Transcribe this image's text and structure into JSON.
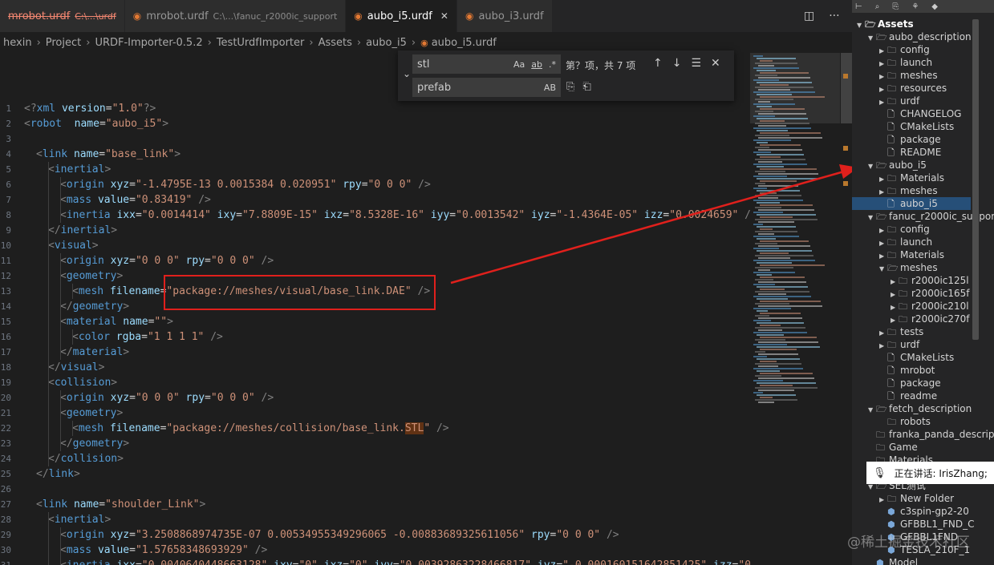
{
  "tabs": [
    {
      "name": "mrobot.urdf",
      "hint": "C:\\...\\urdf",
      "state": "deleted"
    },
    {
      "name": "mrobot.urdf",
      "hint": "C:\\...\\fanuc_r2000ic_support"
    },
    {
      "name": "aubo_i5.urdf",
      "active": true
    },
    {
      "name": "aubo_i3.urdf"
    }
  ],
  "tab_actions": {
    "split_icon": "split-editor-icon",
    "more_icon": "ellipsis-icon",
    "split": "◫",
    "more": "···"
  },
  "breadcrumb": [
    "hexin",
    "Project",
    "URDF-Importer-0.5.2",
    "TestUrdfImporter",
    "Assets",
    "aubo_i5",
    "aubo_i5.urdf"
  ],
  "find": {
    "find_value": "stl",
    "replace_value": "prefab",
    "opt_case": "Aa",
    "opt_word": "ab",
    "opt_regex": ".*",
    "opt_preserve": "AB",
    "result": "第？项，共 7 项",
    "prev": "↑",
    "next": "↓",
    "selection": "☰",
    "close": "✕",
    "replace_one": "⎘",
    "replace_all": "⎗"
  },
  "code": [
    {
      "n": "1",
      "ind": 0,
      "p": [
        [
          "p",
          "<?"
        ],
        [
          "t",
          "xml"
        ],
        [
          "a",
          " version"
        ],
        [
          "x",
          "="
        ],
        [
          "s",
          "\"1.0\""
        ],
        [
          "p",
          "?>"
        ]
      ]
    },
    {
      "n": "2",
      "ind": 0,
      "p": [
        [
          "p",
          "<"
        ],
        [
          "t",
          "robot"
        ],
        [
          "a",
          "  name"
        ],
        [
          "x",
          "="
        ],
        [
          "s",
          "\"aubo_i5\""
        ],
        [
          "p",
          ">"
        ]
      ]
    },
    {
      "n": "3",
      "ind": 0,
      "p": []
    },
    {
      "n": "4",
      "ind": 1,
      "p": [
        [
          "p",
          "<"
        ],
        [
          "t",
          "link"
        ],
        [
          "a",
          " name"
        ],
        [
          "x",
          "="
        ],
        [
          "s",
          "\"base_link\""
        ],
        [
          "p",
          ">"
        ]
      ]
    },
    {
      "n": "5",
      "ind": 2,
      "p": [
        [
          "p",
          "<"
        ],
        [
          "t",
          "inertial"
        ],
        [
          "p",
          ">"
        ]
      ]
    },
    {
      "n": "6",
      "ind": 3,
      "p": [
        [
          "p",
          "<"
        ],
        [
          "t",
          "origin"
        ],
        [
          "a",
          " xyz"
        ],
        [
          "x",
          "="
        ],
        [
          "s",
          "\"-1.4795E-13 0.0015384 0.020951\""
        ],
        [
          "a",
          " rpy"
        ],
        [
          "x",
          "="
        ],
        [
          "s",
          "\"0 0 0\""
        ],
        [
          "p",
          " />"
        ]
      ]
    },
    {
      "n": "7",
      "ind": 3,
      "p": [
        [
          "p",
          "<"
        ],
        [
          "t",
          "mass"
        ],
        [
          "a",
          " value"
        ],
        [
          "x",
          "="
        ],
        [
          "s",
          "\"0.83419\""
        ],
        [
          "p",
          " />"
        ]
      ]
    },
    {
      "n": "8",
      "ind": 3,
      "p": [
        [
          "p",
          "<"
        ],
        [
          "t",
          "inertia"
        ],
        [
          "a",
          " ixx"
        ],
        [
          "x",
          "="
        ],
        [
          "s",
          "\"0.0014414\""
        ],
        [
          "a",
          " ixy"
        ],
        [
          "x",
          "="
        ],
        [
          "s",
          "\"7.8809E-15\""
        ],
        [
          "a",
          " ixz"
        ],
        [
          "x",
          "="
        ],
        [
          "s",
          "\"8.5328E-16\""
        ],
        [
          "a",
          " iyy"
        ],
        [
          "x",
          "="
        ],
        [
          "s",
          "\"0.0013542\""
        ],
        [
          "a",
          " iyz"
        ],
        [
          "x",
          "="
        ],
        [
          "s",
          "\"-1.4364E-05\""
        ],
        [
          "a",
          " izz"
        ],
        [
          "x",
          "="
        ],
        [
          "s",
          "\"0.0024659\""
        ],
        [
          "p",
          " />"
        ]
      ]
    },
    {
      "n": "9",
      "ind": 2,
      "p": [
        [
          "p",
          "</"
        ],
        [
          "t",
          "inertial"
        ],
        [
          "p",
          ">"
        ]
      ]
    },
    {
      "n": "10",
      "ind": 2,
      "p": [
        [
          "p",
          "<"
        ],
        [
          "t",
          "visual"
        ],
        [
          "p",
          ">"
        ]
      ]
    },
    {
      "n": "11",
      "ind": 3,
      "p": [
        [
          "p",
          "<"
        ],
        [
          "t",
          "origin"
        ],
        [
          "a",
          " xyz"
        ],
        [
          "x",
          "="
        ],
        [
          "s",
          "\"0 0 0\""
        ],
        [
          "a",
          " rpy"
        ],
        [
          "x",
          "="
        ],
        [
          "s",
          "\"0 0 0\""
        ],
        [
          "p",
          " />"
        ]
      ]
    },
    {
      "n": "12",
      "ind": 3,
      "p": [
        [
          "p",
          "<"
        ],
        [
          "t",
          "geometry"
        ],
        [
          "p",
          ">"
        ]
      ]
    },
    {
      "n": "13",
      "ind": 4,
      "p": [
        [
          "p",
          "<"
        ],
        [
          "t",
          "mesh"
        ],
        [
          "a",
          " filename"
        ],
        [
          "x",
          "="
        ],
        [
          "s",
          "\"package://meshes/visual/base_link.DAE\""
        ],
        [
          "p",
          " />"
        ]
      ]
    },
    {
      "n": "14",
      "ind": 3,
      "p": [
        [
          "p",
          "</"
        ],
        [
          "t",
          "geometry"
        ],
        [
          "p",
          ">"
        ]
      ]
    },
    {
      "n": "15",
      "ind": 3,
      "p": [
        [
          "p",
          "<"
        ],
        [
          "t",
          "material"
        ],
        [
          "a",
          " name"
        ],
        [
          "x",
          "="
        ],
        [
          "s",
          "\"\""
        ],
        [
          "p",
          ">"
        ]
      ]
    },
    {
      "n": "16",
      "ind": 4,
      "p": [
        [
          "p",
          "<"
        ],
        [
          "t",
          "color"
        ],
        [
          "a",
          " rgba"
        ],
        [
          "x",
          "="
        ],
        [
          "s",
          "\"1 1 1 1\""
        ],
        [
          "p",
          " />"
        ]
      ]
    },
    {
      "n": "17",
      "ind": 3,
      "p": [
        [
          "p",
          "</"
        ],
        [
          "t",
          "material"
        ],
        [
          "p",
          ">"
        ]
      ]
    },
    {
      "n": "18",
      "ind": 2,
      "p": [
        [
          "p",
          "</"
        ],
        [
          "t",
          "visual"
        ],
        [
          "p",
          ">"
        ]
      ]
    },
    {
      "n": "19",
      "ind": 2,
      "p": [
        [
          "p",
          "<"
        ],
        [
          "t",
          "collision"
        ],
        [
          "p",
          ">"
        ]
      ]
    },
    {
      "n": "20",
      "ind": 3,
      "p": [
        [
          "p",
          "<"
        ],
        [
          "t",
          "origin"
        ],
        [
          "a",
          " xyz"
        ],
        [
          "x",
          "="
        ],
        [
          "s",
          "\"0 0 0\""
        ],
        [
          "a",
          " rpy"
        ],
        [
          "x",
          "="
        ],
        [
          "s",
          "\"0 0 0\""
        ],
        [
          "p",
          " />"
        ]
      ]
    },
    {
      "n": "21",
      "ind": 3,
      "p": [
        [
          "p",
          "<"
        ],
        [
          "t",
          "geometry"
        ],
        [
          "p",
          ">"
        ]
      ]
    },
    {
      "n": "22",
      "ind": 4,
      "p": [
        [
          "p",
          "<"
        ],
        [
          "t",
          "mesh"
        ],
        [
          "a",
          " filename"
        ],
        [
          "x",
          "="
        ],
        [
          "s",
          "\"package://meshes/collision/base_link."
        ],
        [
          "hl",
          "STL"
        ],
        [
          "s",
          "\""
        ],
        [
          "p",
          " />"
        ]
      ]
    },
    {
      "n": "23",
      "ind": 3,
      "p": [
        [
          "p",
          "</"
        ],
        [
          "t",
          "geometry"
        ],
        [
          "p",
          ">"
        ]
      ]
    },
    {
      "n": "24",
      "ind": 2,
      "p": [
        [
          "p",
          "</"
        ],
        [
          "t",
          "collision"
        ],
        [
          "p",
          ">"
        ]
      ]
    },
    {
      "n": "25",
      "ind": 1,
      "p": [
        [
          "p",
          "</"
        ],
        [
          "t",
          "link"
        ],
        [
          "p",
          ">"
        ]
      ]
    },
    {
      "n": "26",
      "ind": 0,
      "p": []
    },
    {
      "n": "27",
      "ind": 1,
      "p": [
        [
          "p",
          "<"
        ],
        [
          "t",
          "link"
        ],
        [
          "a",
          " name"
        ],
        [
          "x",
          "="
        ],
        [
          "s",
          "\"shoulder_Link\""
        ],
        [
          "p",
          ">"
        ]
      ]
    },
    {
      "n": "28",
      "ind": 2,
      "p": [
        [
          "p",
          "<"
        ],
        [
          "t",
          "inertial"
        ],
        [
          "p",
          ">"
        ]
      ]
    },
    {
      "n": "29",
      "ind": 3,
      "p": [
        [
          "p",
          "<"
        ],
        [
          "t",
          "origin"
        ],
        [
          "a",
          " xyz"
        ],
        [
          "x",
          "="
        ],
        [
          "s",
          "\"3.2508868974735E-07 0.00534955349296065 -0.00883689325611056\""
        ],
        [
          "a",
          " rpy"
        ],
        [
          "x",
          "="
        ],
        [
          "s",
          "\"0 0 0\""
        ],
        [
          "p",
          " />"
        ]
      ]
    },
    {
      "n": "30",
      "ind": 3,
      "p": [
        [
          "p",
          "<"
        ],
        [
          "t",
          "mass"
        ],
        [
          "a",
          " value"
        ],
        [
          "x",
          "="
        ],
        [
          "s",
          "\"1.57658348693929\""
        ],
        [
          "p",
          " />"
        ]
      ]
    },
    {
      "n": "31",
      "ind": 3,
      "p": [
        [
          "p",
          "<"
        ],
        [
          "t",
          "inertia"
        ],
        [
          "a",
          " ixx"
        ],
        [
          "x",
          "="
        ],
        [
          "s",
          "\"0.0040640448663128\""
        ],
        [
          "a",
          " ixy"
        ],
        [
          "x",
          "="
        ],
        [
          "s",
          "\"0\""
        ],
        [
          "a",
          " ixz"
        ],
        [
          "x",
          "="
        ],
        [
          "s",
          "\"0\""
        ],
        [
          "a",
          " iyy"
        ],
        [
          "x",
          "="
        ],
        [
          "s",
          "\"0.00392863228466817\""
        ],
        [
          "a",
          " iyz"
        ],
        [
          "x",
          "="
        ],
        [
          "s",
          "\"-0.000160151642851425\""
        ],
        [
          "a",
          " izz"
        ],
        [
          "x",
          "="
        ],
        [
          "s",
          "\"0.0"
        ]
      ]
    }
  ],
  "explorer": {
    "toolbar_icons": [
      "collapse-icon",
      "search-icon",
      "open-file-icon",
      "git-icon",
      "tag-icon"
    ],
    "toolbar_glyphs": [
      "⊢",
      "⌕",
      "⎘",
      "⚘",
      "◆"
    ],
    "items": [
      {
        "label": "Assets",
        "depth": 0,
        "kind": "folder",
        "open": true,
        "root": true
      },
      {
        "label": "aubo_description",
        "depth": 1,
        "kind": "folder",
        "open": true
      },
      {
        "label": "config",
        "depth": 2,
        "kind": "folder"
      },
      {
        "label": "launch",
        "depth": 2,
        "kind": "folder"
      },
      {
        "label": "meshes",
        "depth": 2,
        "kind": "folder"
      },
      {
        "label": "resources",
        "depth": 2,
        "kind": "folder"
      },
      {
        "label": "urdf",
        "depth": 2,
        "kind": "folder"
      },
      {
        "label": "CHANGELOG",
        "depth": 2,
        "kind": "file"
      },
      {
        "label": "CMakeLists",
        "depth": 2,
        "kind": "file"
      },
      {
        "label": "package",
        "depth": 2,
        "kind": "file"
      },
      {
        "label": "README",
        "depth": 2,
        "kind": "file"
      },
      {
        "label": "aubo_i5",
        "depth": 1,
        "kind": "folder",
        "open": true
      },
      {
        "label": "Materials",
        "depth": 2,
        "kind": "folder"
      },
      {
        "label": "meshes",
        "depth": 2,
        "kind": "folder"
      },
      {
        "label": "aubo_i5",
        "depth": 2,
        "kind": "file",
        "selected": true
      },
      {
        "label": "fanuc_r2000ic_support",
        "depth": 1,
        "kind": "folder",
        "open": true
      },
      {
        "label": "config",
        "depth": 2,
        "kind": "folder"
      },
      {
        "label": "launch",
        "depth": 2,
        "kind": "folder"
      },
      {
        "label": "Materials",
        "depth": 2,
        "kind": "folder"
      },
      {
        "label": "meshes",
        "depth": 2,
        "kind": "folder",
        "open": true
      },
      {
        "label": "r2000ic125l",
        "depth": 3,
        "kind": "folder"
      },
      {
        "label": "r2000ic165f",
        "depth": 3,
        "kind": "folder"
      },
      {
        "label": "r2000ic210l",
        "depth": 3,
        "kind": "folder"
      },
      {
        "label": "r2000ic270f",
        "depth": 3,
        "kind": "folder"
      },
      {
        "label": "tests",
        "depth": 2,
        "kind": "folder"
      },
      {
        "label": "urdf",
        "depth": 2,
        "kind": "folder"
      },
      {
        "label": "CMakeLists",
        "depth": 2,
        "kind": "file"
      },
      {
        "label": "mrobot",
        "depth": 2,
        "kind": "file"
      },
      {
        "label": "package",
        "depth": 2,
        "kind": "file"
      },
      {
        "label": "readme",
        "depth": 2,
        "kind": "file"
      },
      {
        "label": "fetch_description",
        "depth": 1,
        "kind": "folder",
        "open": true
      },
      {
        "label": "robots",
        "depth": 2,
        "kind": "folder",
        "noarrow": true
      },
      {
        "label": "franka_panda_description",
        "depth": 1,
        "kind": "folder",
        "noarrow": true
      },
      {
        "label": "Game",
        "depth": 1,
        "kind": "folder",
        "noarrow": true
      },
      {
        "label": "Materials",
        "depth": 1,
        "kind": "folder",
        "noarrow": true
      },
      {
        "label": "",
        "depth": 1,
        "kind": "folder",
        "open": true
      },
      {
        "label": "SEL测试",
        "depth": 1,
        "kind": "folder",
        "open": true
      },
      {
        "label": "New Folder",
        "depth": 2,
        "kind": "folder"
      },
      {
        "label": "c3spin-gp2-20",
        "depth": 2,
        "kind": "cube"
      },
      {
        "label": "GFBBL1_FND_C",
        "depth": 2,
        "kind": "cube"
      },
      {
        "label": "GFBBL1FND",
        "depth": 2,
        "kind": "cube"
      },
      {
        "label": "TESLA_210F_1",
        "depth": 2,
        "kind": "cube"
      },
      {
        "label": "Model",
        "depth": 1,
        "kind": "cube"
      }
    ]
  },
  "speaker_overlay": {
    "mic_icon": "microphone-icon",
    "text": "正在讲话: IrisZhang;"
  },
  "watermark": "@稀土掘金技术社区"
}
